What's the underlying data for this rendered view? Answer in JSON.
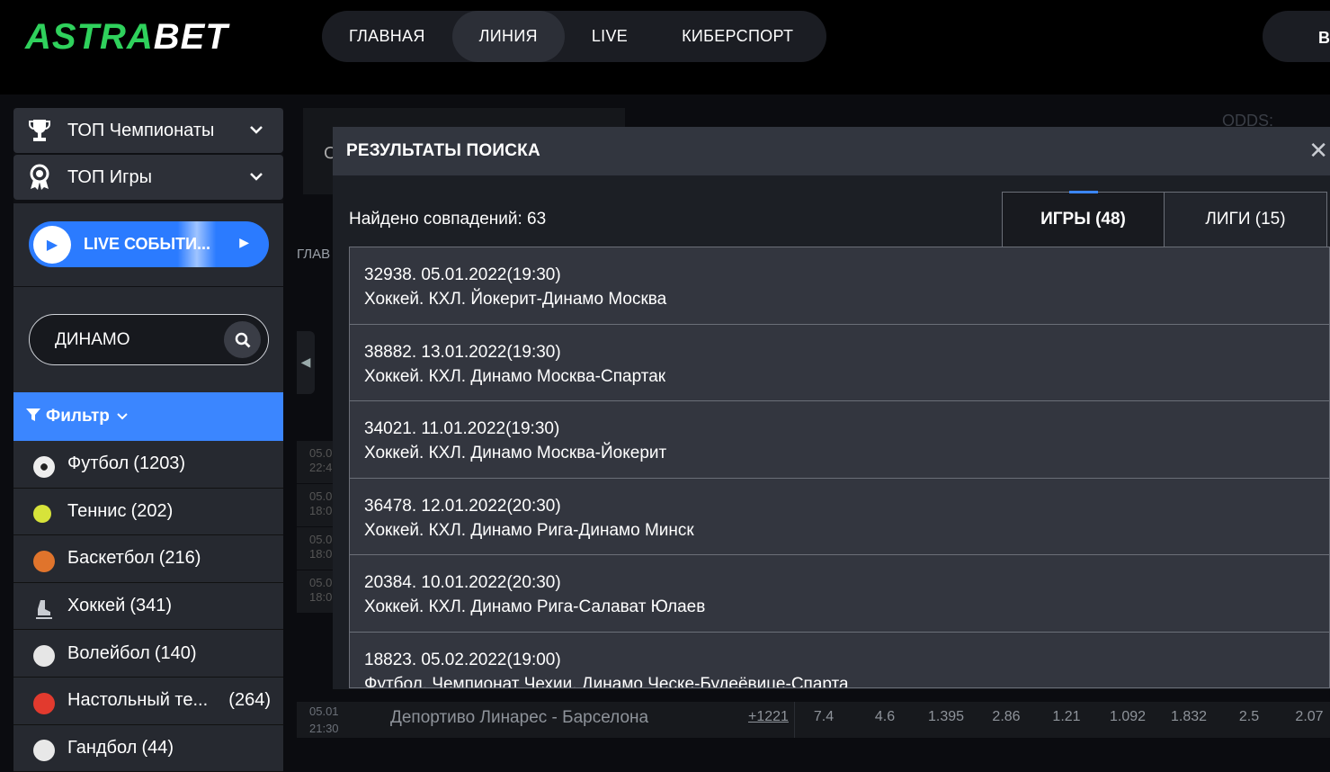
{
  "brand": {
    "logo_a": "ASTRA",
    "logo_b": "BET"
  },
  "nav": {
    "items": [
      {
        "label": "ГЛАВНАЯ",
        "active": false
      },
      {
        "label": "ЛИНИЯ",
        "active": true
      },
      {
        "label": "LIVE",
        "active": false
      },
      {
        "label": "КИБЕРСПОРТ",
        "active": false
      }
    ],
    "login_partial": "В"
  },
  "sidebar": {
    "top_champs": "ТОП Чемпионаты",
    "top_games": "ТОП Игры",
    "live_button": "LIVE СОБЫТИ...",
    "search": {
      "value": "ДИНАМО",
      "placeholder": ""
    },
    "filter_label": "Фильтр",
    "sports": [
      {
        "label": "Футбол",
        "count": "(1203)",
        "icon": "football-icon",
        "color": "#e8e8e8"
      },
      {
        "label": "Теннис",
        "count": "(202)",
        "icon": "tennis-ball-icon",
        "color": "#d7e33a"
      },
      {
        "label": "Баскетбол",
        "count": "(216)",
        "icon": "basketball-icon",
        "color": "#e0742c"
      },
      {
        "label": "Хоккей",
        "count": "(341)",
        "icon": "hockey-skate-icon",
        "color": "#c9ccd2"
      },
      {
        "label": "Волейбол",
        "count": "(140)",
        "icon": "volleyball-icon",
        "color": "#e6e6e6"
      },
      {
        "label": "Настольный те...",
        "count": "(264)",
        "icon": "table-tennis-icon",
        "color": "#e23a2e"
      },
      {
        "label": "Гандбол",
        "count": "(44)",
        "icon": "handball-icon",
        "color": "#e8e8e8"
      }
    ]
  },
  "background": {
    "breadcrumb": "ГЛАВ",
    "odds_label": "ODDS:",
    "partial_c": "C",
    "row_times": [
      "05.0\n22:4",
      "05.0\n18:0",
      "05.0\n18:0",
      "05.0\n18:0"
    ],
    "bottom_row": {
      "time": "05.01\n21:30",
      "teams": "Депортиво Линарес - Барселона",
      "more": "+1221",
      "odds": [
        "7.4",
        "4.6",
        "1.395",
        "2.86",
        "1.21",
        "1.092",
        "1.832",
        "2.5",
        "2.07"
      ]
    }
  },
  "modal": {
    "title": "РЕЗУЛЬТАТЫ ПОИСКА",
    "found": "Найдено совпадений: 63",
    "tabs": [
      {
        "label": "ИГРЫ (48)",
        "active": true
      },
      {
        "label": "ЛИГИ (15)",
        "active": false
      }
    ],
    "results": [
      {
        "line1": "32938. 05.01.2022(19:30)",
        "line2": "Хоккей. КХЛ. Йокерит-Динамо Москва"
      },
      {
        "line1": "38882. 13.01.2022(19:30)",
        "line2": "Хоккей. КХЛ. Динамо Москва-Спартак"
      },
      {
        "line1": "34021. 11.01.2022(19:30)",
        "line2": "Хоккей. КХЛ. Динамо Москва-Йокерит"
      },
      {
        "line1": "36478. 12.01.2022(20:30)",
        "line2": "Хоккей. КХЛ. Динамо Рига-Динамо Минск"
      },
      {
        "line1": "20384. 10.01.2022(20:30)",
        "line2": "Хоккей. КХЛ. Динамо Рига-Салават Юлаев"
      },
      {
        "line1": "18823. 05.02.2022(19:00)",
        "line2": "Футбол. Чемпионат Чехии. Динамо Ческе-Будеёвице-Спарта"
      }
    ]
  }
}
